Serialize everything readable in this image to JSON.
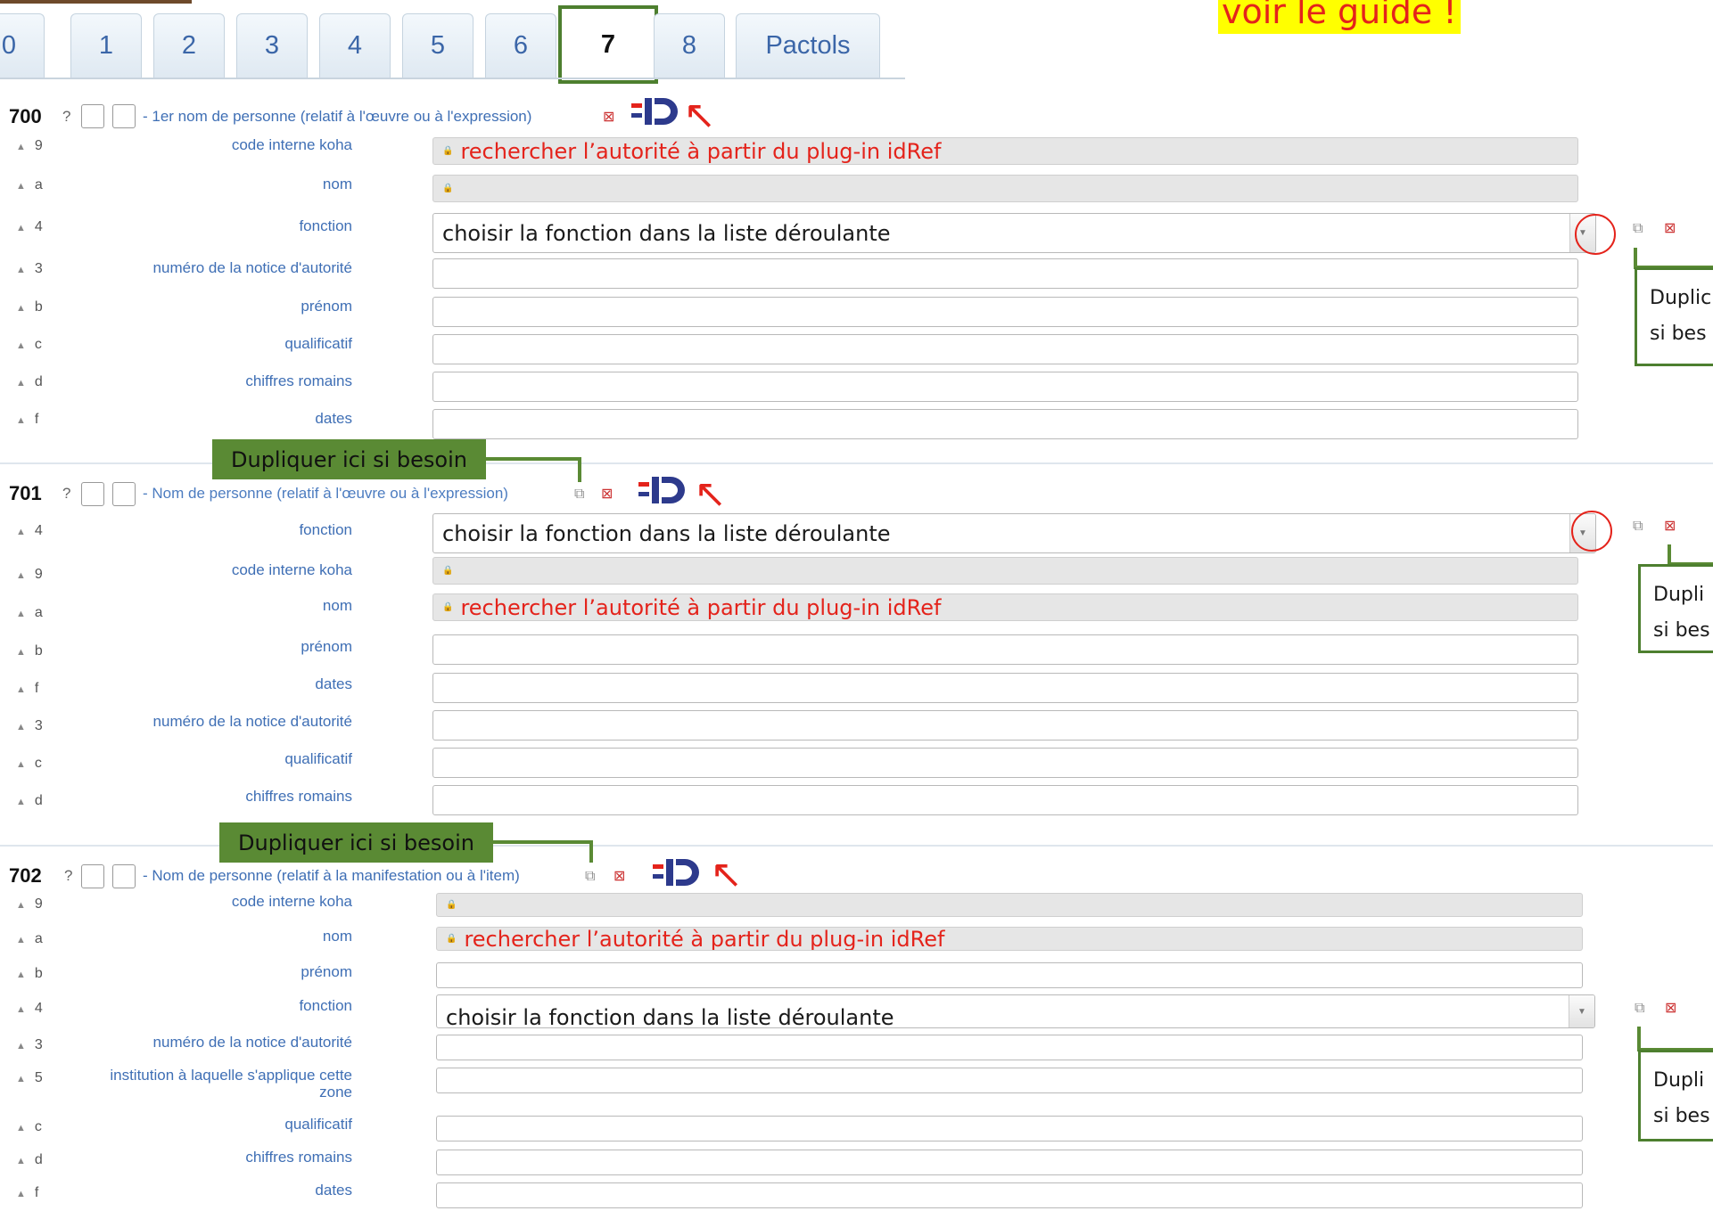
{
  "guide_note": "voir le guide !",
  "tabs": [
    "0",
    "1",
    "2",
    "3",
    "4",
    "5",
    "6",
    "7",
    "8",
    "Pactols"
  ],
  "active_tab": "7",
  "ui": {
    "question_mark": "?",
    "red_search_hint": "rechercher l’autorité à partir du plug-in idRef",
    "select_hint": "choisir la fonction dans la liste déroulante",
    "dup_callout": "Dupliquer ici si besoin",
    "side_note_l1": "Dupli",
    "side_note_l2": "si bes",
    "side_note_first_l1": "Duplic",
    "side_note_first_l2": "si bes"
  },
  "fields": [
    {
      "tag": "700",
      "description": "- 1er nom de personne (relatif à l'œuvre ou à l'expression)",
      "subfields": [
        {
          "code": "9",
          "label": "code interne koha"
        },
        {
          "code": "a",
          "label": "nom"
        },
        {
          "code": "4",
          "label": "fonction"
        },
        {
          "code": "3",
          "label": "numéro de la notice d'autorité"
        },
        {
          "code": "b",
          "label": "prénom"
        },
        {
          "code": "c",
          "label": "qualificatif"
        },
        {
          "code": "d",
          "label": "chiffres romains"
        },
        {
          "code": "f",
          "label": "dates"
        }
      ]
    },
    {
      "tag": "701",
      "description": "- Nom de personne (relatif à l'œuvre ou à l'expression)",
      "subfields": [
        {
          "code": "4",
          "label": "fonction"
        },
        {
          "code": "9",
          "label": "code interne koha"
        },
        {
          "code": "a",
          "label": "nom"
        },
        {
          "code": "b",
          "label": "prénom"
        },
        {
          "code": "f",
          "label": "dates"
        },
        {
          "code": "3",
          "label": "numéro de la notice d'autorité"
        },
        {
          "code": "c",
          "label": "qualificatif"
        },
        {
          "code": "d",
          "label": "chiffres romains"
        }
      ]
    },
    {
      "tag": "702",
      "description": "- Nom de personne (relatif à la manifestation ou à l'item)",
      "subfields": [
        {
          "code": "9",
          "label": "code interne koha"
        },
        {
          "code": "a",
          "label": "nom"
        },
        {
          "code": "b",
          "label": "prénom"
        },
        {
          "code": "4",
          "label": "fonction"
        },
        {
          "code": "3",
          "label": "numéro de la notice d'autorité"
        },
        {
          "code": "5",
          "label": "institution à laquelle s'applique cette zone"
        },
        {
          "code": "c",
          "label": "qualificatif"
        },
        {
          "code": "d",
          "label": "chiffres romains"
        },
        {
          "code": "f",
          "label": "dates"
        }
      ]
    }
  ],
  "colors": {
    "annotation_red": "#e4231b",
    "callout_green": "#5a8a34",
    "label_blue": "#3f6fb5",
    "highlight_yellow": "#ffff00"
  },
  "icons": [
    "duplicate-icon",
    "delete-icon",
    "idref-logo",
    "dropdown-arrow-icon"
  ]
}
